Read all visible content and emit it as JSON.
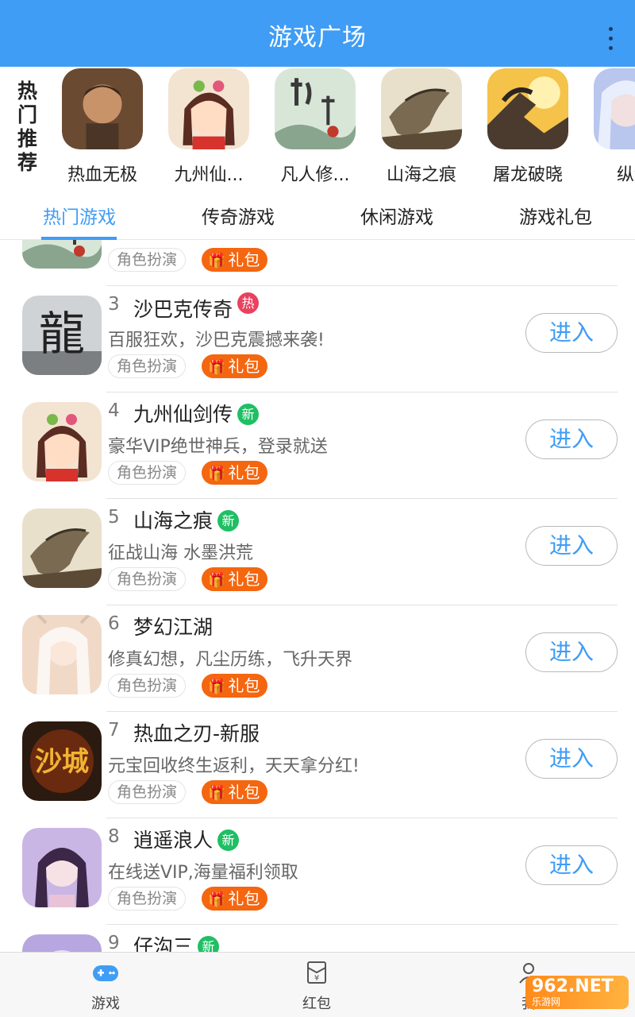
{
  "header": {
    "title": "游戏广场"
  },
  "hot": {
    "label": "热门推荐",
    "items": [
      {
        "name": "热血无极"
      },
      {
        "name": "九州仙..."
      },
      {
        "name": "凡人修..."
      },
      {
        "name": "山海之痕"
      },
      {
        "name": "屠龙破晓"
      },
      {
        "name": "纵剑"
      }
    ]
  },
  "tabs": [
    {
      "label": "热门游戏",
      "active": true
    },
    {
      "label": "传奇游戏"
    },
    {
      "label": "休闲游戏"
    },
    {
      "label": "游戏礼包"
    }
  ],
  "list": {
    "top_partial": {
      "category": "角色扮演",
      "gift": "礼包"
    },
    "rows": [
      {
        "num": "3",
        "name": "沙巴克传奇",
        "badge": "热",
        "desc": "百服狂欢，沙巴克震撼来袭!",
        "category": "角色扮演",
        "gift": "礼包",
        "button": "进入"
      },
      {
        "num": "4",
        "name": "九州仙剑传",
        "badge": "新",
        "desc": "豪华VIP绝世神兵，登录就送",
        "category": "角色扮演",
        "gift": "礼包",
        "button": "进入"
      },
      {
        "num": "5",
        "name": "山海之痕",
        "badge": "新",
        "desc": "征战山海 水墨洪荒",
        "category": "角色扮演",
        "gift": "礼包",
        "button": "进入"
      },
      {
        "num": "6",
        "name": "梦幻江湖",
        "badge": "",
        "desc": "修真幻想，凡尘历练，飞升天界",
        "category": "角色扮演",
        "gift": "礼包",
        "button": "进入"
      },
      {
        "num": "7",
        "name": "热血之刃-新服",
        "badge": "",
        "desc": "元宝回收终生返利，天天拿分红!",
        "category": "角色扮演",
        "gift": "礼包",
        "button": "进入"
      },
      {
        "num": "8",
        "name": "逍遥浪人",
        "badge": "新",
        "desc": "在线送VIP,海量福利领取",
        "category": "角色扮演",
        "gift": "礼包",
        "button": "进入"
      }
    ],
    "bottom_partial": {
      "num": "9",
      "name": "仔沟三",
      "badge": "新"
    }
  },
  "bottom_nav": [
    {
      "label": "游戏",
      "icon": "gamepad-icon"
    },
    {
      "label": "红包",
      "icon": "red-envelope-icon"
    },
    {
      "label": "我",
      "icon": "user-icon"
    }
  ],
  "watermark": {
    "text": "962.NET",
    "sub": "乐游网"
  },
  "colors": {
    "accent": "#3f9df5",
    "gift": "#f4660f",
    "hot_badge": "#e9415e",
    "new_badge": "#1fbf63"
  }
}
